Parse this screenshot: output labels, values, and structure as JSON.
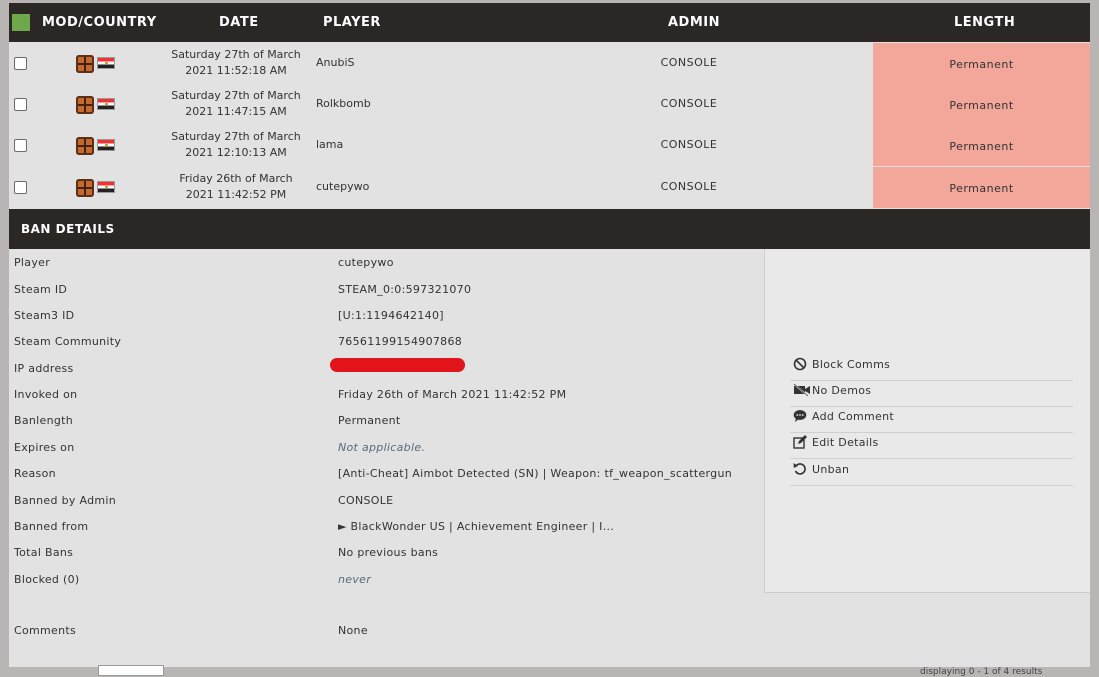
{
  "table": {
    "headers": {
      "mod": "MOD/COUNTRY",
      "date": "DATE",
      "player": "PLAYER",
      "admin": "ADMIN",
      "length": "LENGTH"
    },
    "rows": [
      {
        "date_line1": "Saturday 27th of March",
        "date_line2": "2021 11:52:18 AM",
        "player": "AnubiS",
        "admin": "CONSOLE",
        "length": "Permanent"
      },
      {
        "date_line1": "Saturday 27th of March",
        "date_line2": "2021 11:47:15 AM",
        "player": "Rolkbomb",
        "admin": "CONSOLE",
        "length": "Permanent"
      },
      {
        "date_line1": "Saturday 27th of March",
        "date_line2": "2021 12:10:13 AM",
        "player": "lama",
        "admin": "CONSOLE",
        "length": "Permanent"
      },
      {
        "date_line1": "Friday 26th of March",
        "date_line2": "2021 11:42:52 PM",
        "player": "cutepywo",
        "admin": "CONSOLE",
        "length": "Permanent"
      }
    ]
  },
  "details": {
    "title": "BAN DETAILS",
    "fields": [
      {
        "key": "Player",
        "value": "cutepywo"
      },
      {
        "key": "Steam ID",
        "value": "STEAM_0:0:597321070"
      },
      {
        "key": "Steam3 ID",
        "value": "[U:1:1194642140]"
      },
      {
        "key": "Steam Community",
        "value": "76561199154907868"
      },
      {
        "key": "IP address",
        "value": ""
      },
      {
        "key": "Invoked on",
        "value": "Friday 26th of March 2021 11:42:52 PM"
      },
      {
        "key": "Banlength",
        "value": "Permanent"
      },
      {
        "key": "Expires on",
        "value": "Not applicable."
      },
      {
        "key": "Reason",
        "value": "[Anti-Cheat] Aimbot Detected (SN) | Weapon: tf_weapon_scattergun"
      },
      {
        "key": "Banned by Admin",
        "value": "CONSOLE"
      },
      {
        "key": "Banned from",
        "value": "► BlackWonder US | Achievement Engineer | I..."
      },
      {
        "key": "Total Bans",
        "value": "No previous bans"
      },
      {
        "key": "Blocked (0)",
        "value": "never"
      },
      {
        "key": "Comments",
        "value": "None"
      }
    ]
  },
  "actions": [
    {
      "label": "Block Comms",
      "icon": "block-icon"
    },
    {
      "label": "No Demos",
      "icon": "video-off-icon"
    },
    {
      "label": "Add Comment",
      "icon": "comment-icon"
    },
    {
      "label": "Edit Details",
      "icon": "edit-icon"
    },
    {
      "label": "Unban",
      "icon": "undo-icon"
    }
  ],
  "footer": {
    "text": "displaying 0 - 1 of 4 results"
  },
  "colors": {
    "header_bg": "#2b2724",
    "permanent_bg": "#f2a79a",
    "select_all": "#6fa84a",
    "redaction": "#e0141a"
  }
}
